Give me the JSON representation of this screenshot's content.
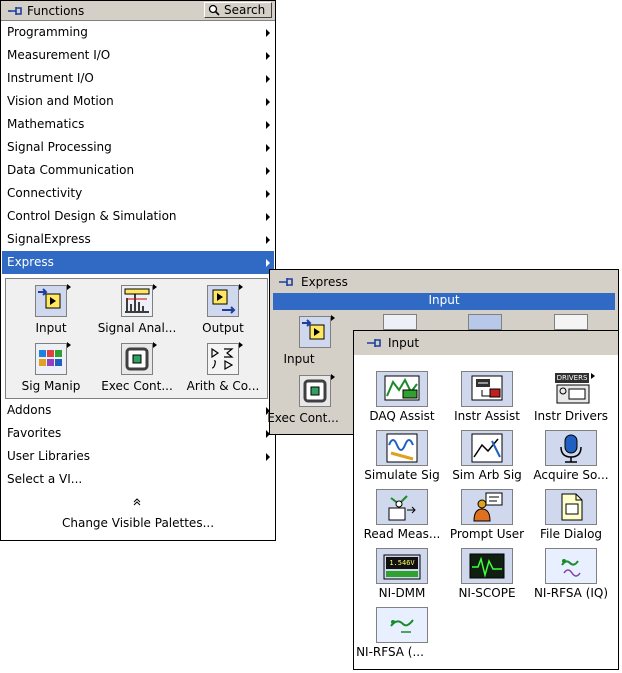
{
  "functions_palette": {
    "title": "Functions",
    "search_label": "Search",
    "menu_items": [
      {
        "label": "Programming",
        "submenu": true
      },
      {
        "label": "Measurement I/O",
        "submenu": true
      },
      {
        "label": "Instrument I/O",
        "submenu": true
      },
      {
        "label": "Vision and Motion",
        "submenu": true
      },
      {
        "label": "Mathematics",
        "submenu": true
      },
      {
        "label": "Signal Processing",
        "submenu": true
      },
      {
        "label": "Data Communication",
        "submenu": true
      },
      {
        "label": "Connectivity",
        "submenu": true
      },
      {
        "label": "Control Design & Simulation",
        "submenu": true
      },
      {
        "label": "SignalExpress",
        "submenu": true
      },
      {
        "label": "Express",
        "submenu": true,
        "selected": true
      }
    ],
    "express_tiles": [
      {
        "label": "Input",
        "icon": "input-icon"
      },
      {
        "label": "Signal Anal...",
        "icon": "signal-analysis-icon"
      },
      {
        "label": "Output",
        "icon": "output-icon"
      },
      {
        "label": "Sig Manip",
        "icon": "signal-manipulation-icon"
      },
      {
        "label": "Exec Cont...",
        "icon": "execution-control-icon"
      },
      {
        "label": "Arith & Co...",
        "icon": "arithmetic-comparison-icon"
      }
    ],
    "lower_items": [
      {
        "label": "Addons",
        "submenu": true
      },
      {
        "label": "Favorites",
        "submenu": true
      },
      {
        "label": "User Libraries",
        "submenu": true
      },
      {
        "label": "Select a VI...",
        "submenu": false
      }
    ],
    "change_palettes_label": "Change Visible Palettes..."
  },
  "express_palette": {
    "title": "Express",
    "selected_label": "Input",
    "tiles": [
      {
        "label": "Input",
        "icon": "input-icon"
      },
      {
        "label": "Exec Cont...",
        "icon": "execution-control-icon"
      }
    ]
  },
  "input_palette": {
    "title": "Input",
    "tiles": [
      {
        "label": "DAQ Assist",
        "icon": "daq-assistant-icon"
      },
      {
        "label": "Instr Assist",
        "icon": "instrument-assistant-icon"
      },
      {
        "label": "Instr Drivers",
        "icon": "instrument-drivers-icon"
      },
      {
        "label": "Simulate Sig",
        "icon": "simulate-signal-icon"
      },
      {
        "label": "Sim Arb Sig",
        "icon": "simulate-arbitrary-signal-icon"
      },
      {
        "label": "Acquire So...",
        "icon": "acquire-sound-icon"
      },
      {
        "label": "Read Meas...",
        "icon": "read-measurement-file-icon"
      },
      {
        "label": "Prompt User",
        "icon": "prompt-user-icon"
      },
      {
        "label": "File Dialog",
        "icon": "file-dialog-icon"
      },
      {
        "label": "NI-DMM",
        "icon": "ni-dmm-icon"
      },
      {
        "label": "NI-SCOPE",
        "icon": "ni-scope-icon"
      },
      {
        "label": "NI-RFSA (IQ)",
        "icon": "ni-rfsa-iq-icon"
      },
      {
        "label": "NI-RFSA (...",
        "icon": "ni-rfsa-icon"
      }
    ],
    "instr_drivers_badge": "DRIVERS",
    "dmm_readout": "1.546V"
  },
  "colors": {
    "selection": "#316ac5",
    "chrome": "#d4d0c8",
    "icon_fill": "#b8c8e8"
  }
}
